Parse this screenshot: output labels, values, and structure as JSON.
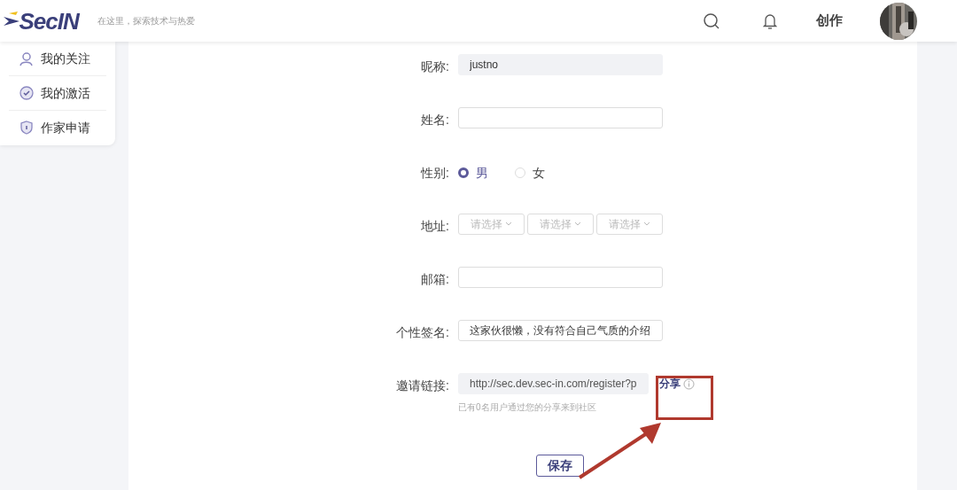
{
  "header": {
    "logo": "SecIN",
    "slogan": "在这里，探索技术与热爱",
    "create_label": "创作"
  },
  "sidebar": {
    "items": [
      {
        "label": "我的关注"
      },
      {
        "label": "我的激活"
      },
      {
        "label": "作家申请"
      }
    ]
  },
  "form": {
    "fields": [
      {
        "kind": "text",
        "label": "昵称:",
        "value": "justno",
        "disabled": true
      },
      {
        "kind": "text",
        "label": "姓名:",
        "disabled": false
      },
      {
        "kind": "radio",
        "label": "性别:",
        "options": [
          {
            "label": "男",
            "selected": true
          },
          {
            "label": "女",
            "selected": false
          }
        ]
      },
      {
        "kind": "selects",
        "label": "地址:",
        "selects": [
          {
            "placeholder": "请选择"
          },
          {
            "placeholder": "请选择"
          },
          {
            "placeholder": "请选择"
          }
        ]
      },
      {
        "kind": "text",
        "label": "邮箱:",
        "disabled": false
      },
      {
        "kind": "text",
        "label": "个性签名:",
        "value": "这家伙很懒，没有符合自己气质的介绍",
        "disabled": false
      },
      {
        "kind": "link",
        "label": "邀请链接:",
        "value": "http://sec.dev.sec-in.com/register?p",
        "share": "分享",
        "hint": "已有0名用户通过您的分享来到社区"
      }
    ],
    "save": "保存"
  },
  "annotation": {
    "highlight": true
  }
}
